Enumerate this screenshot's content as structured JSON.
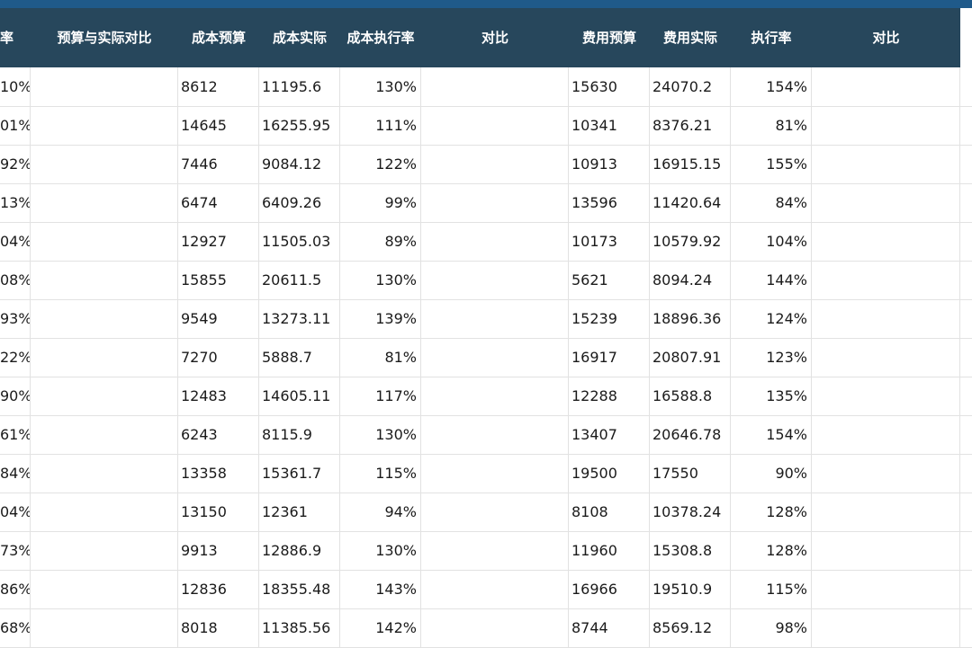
{
  "header": {
    "c0": "率",
    "c1": "预算与实际对比",
    "c2": "成本预算",
    "c3": "成本实际",
    "c4": "成本执行率",
    "c5": "对比",
    "c6": "费用预算",
    "c7": "费用实际",
    "c8": "执行率",
    "c9": "对比"
  },
  "rows": [
    {
      "rate": "10%",
      "cost_budget": "8612",
      "cost_actual": "11195.6",
      "cost_rate": "130%",
      "fee_budget": "15630",
      "fee_actual": "24070.2",
      "fee_rate": "154%"
    },
    {
      "rate": "01%",
      "cost_budget": "14645",
      "cost_actual": "16255.95",
      "cost_rate": "111%",
      "fee_budget": "10341",
      "fee_actual": "8376.21",
      "fee_rate": "81%"
    },
    {
      "rate": "92%",
      "cost_budget": "7446",
      "cost_actual": "9084.12",
      "cost_rate": "122%",
      "fee_budget": "10913",
      "fee_actual": "16915.15",
      "fee_rate": "155%"
    },
    {
      "rate": "13%",
      "cost_budget": "6474",
      "cost_actual": "6409.26",
      "cost_rate": "99%",
      "fee_budget": "13596",
      "fee_actual": "11420.64",
      "fee_rate": "84%"
    },
    {
      "rate": "04%",
      "cost_budget": "12927",
      "cost_actual": "11505.03",
      "cost_rate": "89%",
      "fee_budget": "10173",
      "fee_actual": "10579.92",
      "fee_rate": "104%"
    },
    {
      "rate": "08%",
      "cost_budget": "15855",
      "cost_actual": "20611.5",
      "cost_rate": "130%",
      "fee_budget": "5621",
      "fee_actual": "8094.24",
      "fee_rate": "144%"
    },
    {
      "rate": "93%",
      "cost_budget": "9549",
      "cost_actual": "13273.11",
      "cost_rate": "139%",
      "fee_budget": "15239",
      "fee_actual": "18896.36",
      "fee_rate": "124%"
    },
    {
      "rate": "22%",
      "cost_budget": "7270",
      "cost_actual": "5888.7",
      "cost_rate": "81%",
      "fee_budget": "16917",
      "fee_actual": "20807.91",
      "fee_rate": "123%"
    },
    {
      "rate": "90%",
      "cost_budget": "12483",
      "cost_actual": "14605.11",
      "cost_rate": "117%",
      "fee_budget": "12288",
      "fee_actual": "16588.8",
      "fee_rate": "135%"
    },
    {
      "rate": "61%",
      "cost_budget": "6243",
      "cost_actual": "8115.9",
      "cost_rate": "130%",
      "fee_budget": "13407",
      "fee_actual": "20646.78",
      "fee_rate": "154%"
    },
    {
      "rate": "84%",
      "cost_budget": "13358",
      "cost_actual": "15361.7",
      "cost_rate": "115%",
      "fee_budget": "19500",
      "fee_actual": "17550",
      "fee_rate": "90%"
    },
    {
      "rate": "04%",
      "cost_budget": "13150",
      "cost_actual": "12361",
      "cost_rate": "94%",
      "fee_budget": "8108",
      "fee_actual": "10378.24",
      "fee_rate": "128%"
    },
    {
      "rate": "73%",
      "cost_budget": "9913",
      "cost_actual": "12886.9",
      "cost_rate": "130%",
      "fee_budget": "11960",
      "fee_actual": "15308.8",
      "fee_rate": "128%"
    },
    {
      "rate": "86%",
      "cost_budget": "12836",
      "cost_actual": "18355.48",
      "cost_rate": "143%",
      "fee_budget": "16966",
      "fee_actual": "19510.9",
      "fee_rate": "115%"
    },
    {
      "rate": "68%",
      "cost_budget": "8018",
      "cost_actual": "11385.56",
      "cost_rate": "142%",
      "fee_budget": "8744",
      "fee_actual": "8569.12",
      "fee_rate": "98%"
    }
  ]
}
